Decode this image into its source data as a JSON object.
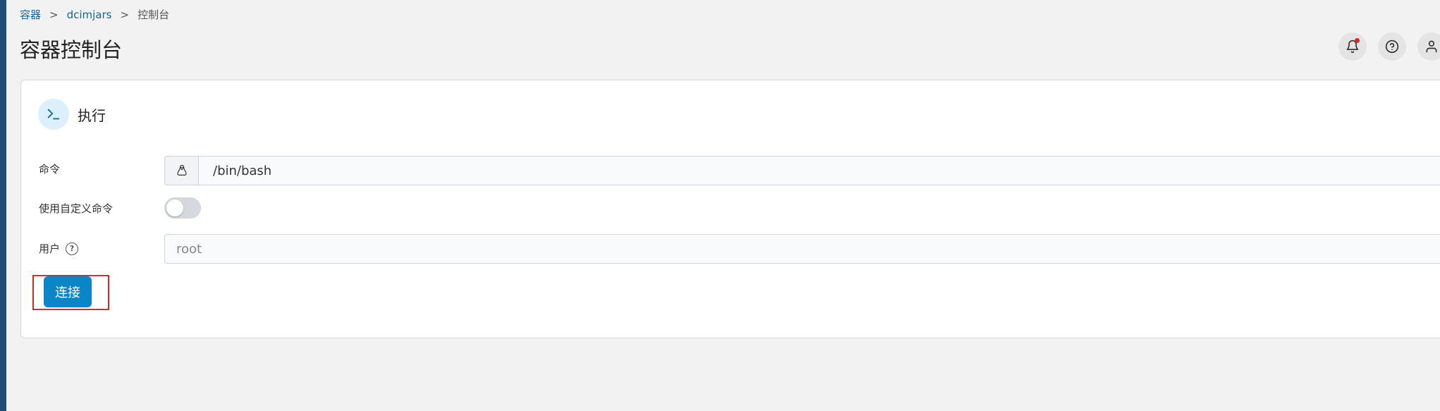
{
  "breadcrumb": {
    "root": "容器",
    "separator": ">",
    "container": "dcimjars",
    "current": "控制台"
  },
  "page": {
    "title": "容器控制台"
  },
  "panel": {
    "title": "执行",
    "command_label": "命令",
    "command_value": "/bin/bash",
    "custom_command_label": "使用自定义命令",
    "custom_command_enabled": false,
    "user_label": "用户",
    "user_placeholder": "root",
    "connect_label": "连接"
  },
  "colors": {
    "accent": "#0a85c7",
    "highlight_border": "#e0242c",
    "notification_dot": "#e02424"
  }
}
